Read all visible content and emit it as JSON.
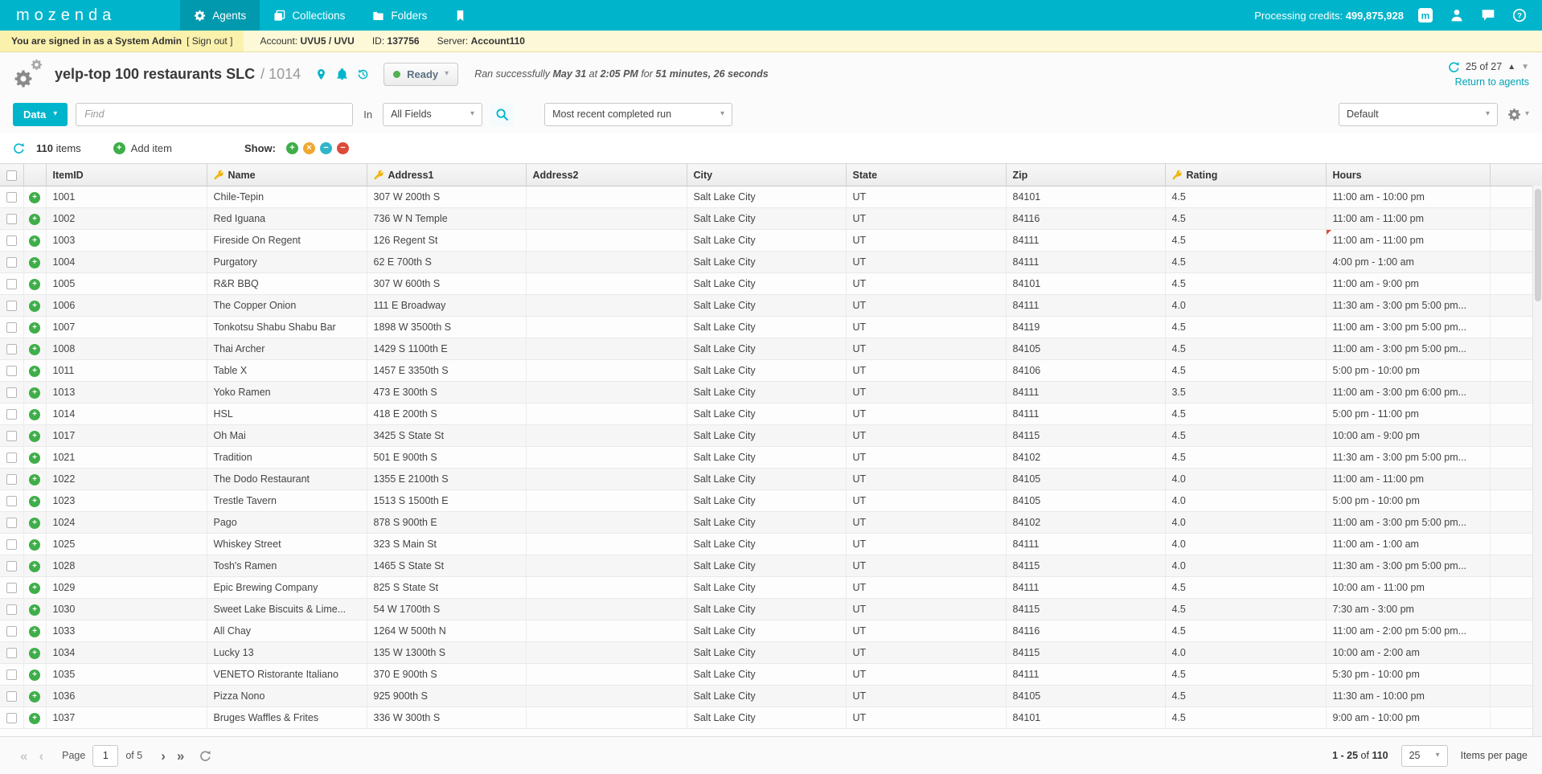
{
  "nav": {
    "logo": "mozenda",
    "items": [
      {
        "label": "Agents"
      },
      {
        "label": "Collections"
      },
      {
        "label": "Folders"
      }
    ],
    "credits_label": "Processing credits:",
    "credits_value": "499,875,928"
  },
  "admin_bar": {
    "signed_in": "You are signed in as a System Admin",
    "sign_out": "[ Sign out ]",
    "account_label": "Account:",
    "account": "UVU5 / UVU",
    "id_label": "ID:",
    "id": "137756",
    "server_label": "Server:",
    "server": "Account110"
  },
  "header": {
    "title": "yelp-top 100 restaurants SLC",
    "agent_id": "/ 1014",
    "status": "Ready",
    "run_prefix": "Ran successfully",
    "run_date": "May 31",
    "run_at": "at",
    "run_time": "2:05 PM",
    "run_for": "for",
    "run_duration": "51 minutes, 26 seconds",
    "field_pager": "25 of 27",
    "return_link": "Return to agents"
  },
  "toolbar": {
    "data_button": "Data",
    "find_placeholder": "Find",
    "in_label": "In",
    "fields_value": "All Fields",
    "run_value": "Most recent completed run",
    "view_value": "Default"
  },
  "items_bar": {
    "count": "110",
    "items_label": "items",
    "add_item": "Add item",
    "show_label": "Show:"
  },
  "table": {
    "columns": [
      {
        "label": "ItemID",
        "key": false
      },
      {
        "label": "Name",
        "key": true
      },
      {
        "label": "Address1",
        "key": true
      },
      {
        "label": "Address2",
        "key": false
      },
      {
        "label": "City",
        "key": false
      },
      {
        "label": "State",
        "key": false
      },
      {
        "label": "Zip",
        "key": false
      },
      {
        "label": "Rating",
        "key": true
      },
      {
        "label": "Hours",
        "key": false
      }
    ],
    "rows": [
      [
        "1001",
        "Chile-Tepin",
        "307 W 200th S",
        "",
        "Salt Lake City",
        "UT",
        "84101",
        "4.5",
        "11:00 am - 10:00 pm"
      ],
      [
        "1002",
        "Red Iguana",
        "736 W N Temple",
        "",
        "Salt Lake City",
        "UT",
        "84116",
        "4.5",
        "11:00 am - 11:00 pm"
      ],
      [
        "1003",
        "Fireside On Regent",
        "126 Regent St",
        "",
        "Salt Lake City",
        "UT",
        "84111",
        "4.5",
        "11:00 am - 11:00 pm"
      ],
      [
        "1004",
        "Purgatory",
        "62 E 700th S",
        "",
        "Salt Lake City",
        "UT",
        "84111",
        "4.5",
        "4:00 pm - 1:00 am"
      ],
      [
        "1005",
        "R&R BBQ",
        "307 W 600th S",
        "",
        "Salt Lake City",
        "UT",
        "84101",
        "4.5",
        "11:00 am - 9:00 pm"
      ],
      [
        "1006",
        "The Copper Onion",
        "111 E Broadway",
        "",
        "Salt Lake City",
        "UT",
        "84111",
        "4.0",
        "11:30 am - 3:00 pm 5:00 pm..."
      ],
      [
        "1007",
        "Tonkotsu Shabu Shabu Bar",
        "1898 W 3500th S",
        "",
        "Salt Lake City",
        "UT",
        "84119",
        "4.5",
        "11:00 am - 3:00 pm 5:00 pm..."
      ],
      [
        "1008",
        "Thai Archer",
        "1429 S 1100th E",
        "",
        "Salt Lake City",
        "UT",
        "84105",
        "4.5",
        "11:00 am - 3:00 pm 5:00 pm..."
      ],
      [
        "1011",
        "Table X",
        "1457 E 3350th S",
        "",
        "Salt Lake City",
        "UT",
        "84106",
        "4.5",
        "5:00 pm - 10:00 pm"
      ],
      [
        "1013",
        "Yoko Ramen",
        "473 E 300th S",
        "",
        "Salt Lake City",
        "UT",
        "84111",
        "3.5",
        "11:00 am - 3:00 pm 6:00 pm..."
      ],
      [
        "1014",
        "HSL",
        "418 E 200th S",
        "",
        "Salt Lake City",
        "UT",
        "84111",
        "4.5",
        "5:00 pm - 11:00 pm"
      ],
      [
        "1017",
        "Oh Mai",
        "3425 S State St",
        "",
        "Salt Lake City",
        "UT",
        "84115",
        "4.5",
        "10:00 am - 9:00 pm"
      ],
      [
        "1021",
        "Tradition",
        "501 E 900th S",
        "",
        "Salt Lake City",
        "UT",
        "84102",
        "4.5",
        "11:30 am - 3:00 pm 5:00 pm..."
      ],
      [
        "1022",
        "The Dodo Restaurant",
        "1355 E 2100th S",
        "",
        "Salt Lake City",
        "UT",
        "84105",
        "4.0",
        "11:00 am - 11:00 pm"
      ],
      [
        "1023",
        "Trestle Tavern",
        "1513 S 1500th E",
        "",
        "Salt Lake City",
        "UT",
        "84105",
        "4.0",
        "5:00 pm - 10:00 pm"
      ],
      [
        "1024",
        "Pago",
        "878 S 900th E",
        "",
        "Salt Lake City",
        "UT",
        "84102",
        "4.0",
        "11:00 am - 3:00 pm 5:00 pm..."
      ],
      [
        "1025",
        "Whiskey Street",
        "323 S Main St",
        "",
        "Salt Lake City",
        "UT",
        "84111",
        "4.0",
        "11:00 am - 1:00 am"
      ],
      [
        "1028",
        "Tosh's Ramen",
        "1465 S State St",
        "",
        "Salt Lake City",
        "UT",
        "84115",
        "4.0",
        "11:30 am - 3:00 pm 5:00 pm..."
      ],
      [
        "1029",
        "Epic Brewing Company",
        "825 S State St",
        "",
        "Salt Lake City",
        "UT",
        "84111",
        "4.5",
        "10:00 am - 11:00 pm"
      ],
      [
        "1030",
        "Sweet Lake Biscuits & Lime...",
        "54 W 1700th S",
        "",
        "Salt Lake City",
        "UT",
        "84115",
        "4.5",
        "7:30 am - 3:00 pm"
      ],
      [
        "1033",
        "All Chay",
        "1264 W 500th N",
        "",
        "Salt Lake City",
        "UT",
        "84116",
        "4.5",
        "11:00 am - 2:00 pm 5:00 pm..."
      ],
      [
        "1034",
        "Lucky 13",
        "135 W 1300th S",
        "",
        "Salt Lake City",
        "UT",
        "84115",
        "4.0",
        "10:00 am - 2:00 am"
      ],
      [
        "1035",
        "VENETO Ristorante Italiano",
        "370 E 900th S",
        "",
        "Salt Lake City",
        "UT",
        "84111",
        "4.5",
        "5:30 pm - 10:00 pm"
      ],
      [
        "1036",
        "Pizza Nono",
        "925 900th S",
        "",
        "Salt Lake City",
        "UT",
        "84105",
        "4.5",
        "11:30 am - 10:00 pm"
      ],
      [
        "1037",
        "Bruges Waffles & Frites",
        "336 W 300th S",
        "",
        "Salt Lake City",
        "UT",
        "84101",
        "4.5",
        "9:00 am - 10:00 pm"
      ]
    ],
    "comment_flag": {
      "row_index": 2,
      "cell_index": 8
    }
  },
  "pager": {
    "page_label": "Page",
    "page_value": "1",
    "of_label": "of 5",
    "range": "1 - 25",
    "of_word": "of",
    "total": "110",
    "page_size": "25",
    "items_per_page": "Items per page"
  },
  "colors": {
    "brand": "#00b5cb",
    "nav_active_bg": "#0099ad",
    "admin_bar_bg": "#fdf9d8",
    "admin_bar_left_bg": "#faf1ad",
    "status_green": "#52b152",
    "key_gold": "#edb60b",
    "add_green": "#3fae49",
    "excl_orange": "#f0a830",
    "neutral_blue": "#2fb6c9",
    "removed_red": "#dd4b39",
    "link_teal": "#00a3b8"
  },
  "icons": {
    "nav_agents": "gear",
    "nav_collections": "stacked-windows",
    "nav_folders": "folder",
    "nav_bookmark": "bookmark",
    "mozenda_app": "m-square",
    "user": "person",
    "feedback": "chat-bubble",
    "help": "question-circle",
    "agent": "double-gear",
    "test": "map-pin",
    "notifications": "bell",
    "run_history": "clock-history",
    "refresh": "circular-arrow",
    "search": "magnifier",
    "unique_field": "key",
    "add": "plus-circle",
    "show_included": "plus-circle-green",
    "show_excluded": "x-circle-orange",
    "show_neutral": "minus-circle-blue",
    "show_removed": "minus-circle-red"
  }
}
